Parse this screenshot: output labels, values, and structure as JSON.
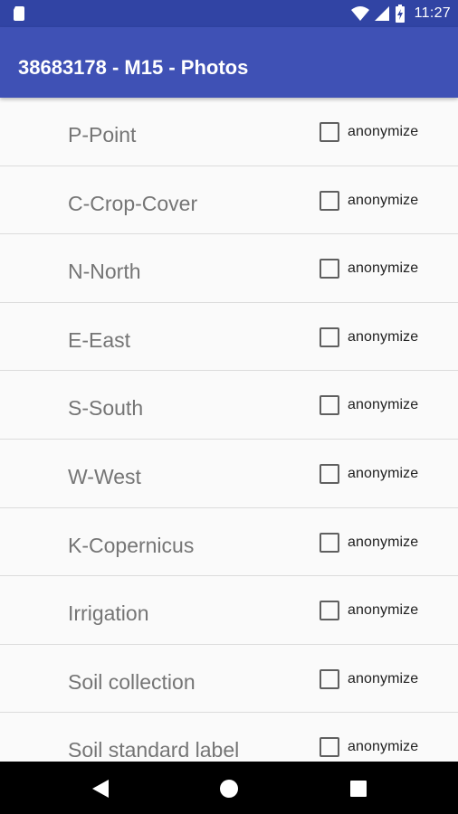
{
  "status_bar": {
    "time": "11:27",
    "icons": [
      "sim-card-icon",
      "wifi-icon",
      "cell-signal-icon",
      "battery-charging-icon"
    ]
  },
  "app_bar": {
    "title": "38683178 - M15 - Photos"
  },
  "photo_list": {
    "items": [
      {
        "label": "P-Point",
        "checkbox_label": "anonymize",
        "checked": false
      },
      {
        "label": "C-Crop-Cover",
        "checkbox_label": "anonymize",
        "checked": false
      },
      {
        "label": "N-North",
        "checkbox_label": "anonymize",
        "checked": false
      },
      {
        "label": "E-East",
        "checkbox_label": "anonymize",
        "checked": false
      },
      {
        "label": "S-South",
        "checkbox_label": "anonymize",
        "checked": false
      },
      {
        "label": "W-West",
        "checkbox_label": "anonymize",
        "checked": false
      },
      {
        "label": "K-Copernicus",
        "checkbox_label": "anonymize",
        "checked": false
      },
      {
        "label": "Irrigation",
        "checkbox_label": "anonymize",
        "checked": false
      },
      {
        "label": "Soil collection",
        "checkbox_label": "anonymize",
        "checked": false
      },
      {
        "label": "Soil standard label",
        "checkbox_label": "anonymize",
        "checked": false
      }
    ]
  },
  "nav_bar": {
    "buttons": [
      "back-icon",
      "home-icon",
      "recents-icon"
    ]
  },
  "colors": {
    "status_bar": "#3144a4",
    "app_bar": "#3f51b5",
    "background": "#fafafa",
    "nav_bar": "#000000"
  }
}
